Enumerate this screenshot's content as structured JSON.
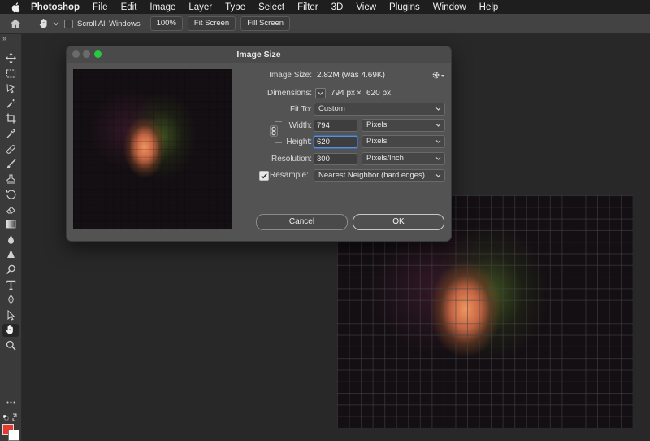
{
  "menubar": {
    "app": "Photoshop",
    "items": [
      "File",
      "Edit",
      "Image",
      "Layer",
      "Type",
      "Select",
      "Filter",
      "3D",
      "View",
      "Plugins",
      "Window",
      "Help"
    ]
  },
  "options_bar": {
    "scroll_all_windows": "Scroll All Windows",
    "zoom_100": "100%",
    "fit_screen": "Fit Screen",
    "fill_screen": "Fill Screen"
  },
  "toolbar": {
    "collapse": "»",
    "foreground_color": "#e53b2f",
    "background_color": "#ffffff"
  },
  "dialog": {
    "title": "Image Size",
    "image_size_label": "Image Size:",
    "image_size_value": "2.82M (was 4.69K)",
    "dimensions_label": "Dimensions:",
    "dimensions_width": "794 px",
    "dimensions_sep": "×",
    "dimensions_height": "620 px",
    "fit_to_label": "Fit To:",
    "fit_to_value": "Custom",
    "width_label": "Width:",
    "width_value": "794",
    "width_unit": "Pixels",
    "height_label": "Height:",
    "height_value": "620",
    "height_unit": "Pixels",
    "resolution_label": "Resolution:",
    "resolution_value": "300",
    "resolution_unit": "Pixels/Inch",
    "resample_label": "Resample:",
    "resample_checked": true,
    "resample_value": "Nearest Neighbor (hard edges)",
    "cancel": "Cancel",
    "ok": "OK"
  }
}
